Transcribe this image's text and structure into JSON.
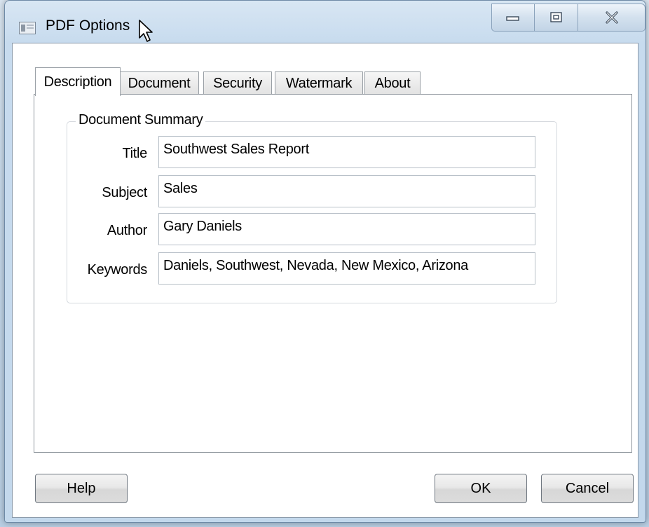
{
  "window": {
    "title": "PDF Options"
  },
  "tabs": [
    {
      "label": "Description",
      "active": true
    },
    {
      "label": "Document",
      "active": false
    },
    {
      "label": "Security",
      "active": false
    },
    {
      "label": "Watermark",
      "active": false
    },
    {
      "label": "About",
      "active": false
    }
  ],
  "summary": {
    "legend": "Document Summary",
    "fields": [
      {
        "label": "Title",
        "value": "Southwest Sales Report"
      },
      {
        "label": "Subject",
        "value": "Sales"
      },
      {
        "label": "Author",
        "value": "Gary Daniels"
      },
      {
        "label": "Keywords",
        "value": "Daniels, Southwest, Nevada, New Mexico, Arizona"
      }
    ]
  },
  "buttons": {
    "help": "Help",
    "ok": "OK",
    "cancel": "Cancel"
  },
  "icons": {
    "app": "document-icon",
    "minimize": "minimize-icon",
    "maximize": "maximize-icon",
    "close": "close-icon",
    "cursor": "mouse-pointer-icon"
  },
  "colors": {
    "titlebar": "#c7dbee",
    "client": "#ffffff",
    "border": "#8a99aa"
  }
}
